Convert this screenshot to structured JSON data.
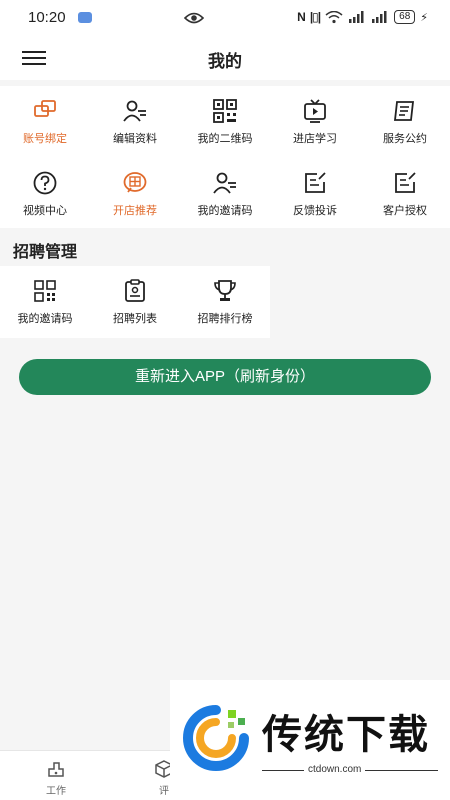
{
  "status_bar": {
    "time": "10:20",
    "battery": "68"
  },
  "header": {
    "title": "我的"
  },
  "grid": {
    "row1": [
      {
        "label": "账号绑定",
        "icon": "account-bind-icon"
      },
      {
        "label": "编辑资料",
        "icon": "edit-profile-icon"
      },
      {
        "label": "我的二维码",
        "icon": "qr-code-icon"
      },
      {
        "label": "进店学习",
        "icon": "tv-play-icon"
      },
      {
        "label": "服务公约",
        "icon": "contract-icon"
      }
    ],
    "row2": [
      {
        "label": "视频中心",
        "icon": "help-circle-icon"
      },
      {
        "label": "开店推荐",
        "icon": "alliance-icon"
      },
      {
        "label": "我的邀请码",
        "icon": "person-icon"
      },
      {
        "label": "反馈投诉",
        "icon": "feedback-icon"
      },
      {
        "label": "客户授权",
        "icon": "authorize-icon"
      }
    ]
  },
  "recruit": {
    "title": "招聘管理",
    "items": [
      {
        "label": "我的邀请码",
        "icon": "qr-code-icon"
      },
      {
        "label": "招聘列表",
        "icon": "list-icon"
      },
      {
        "label": "招聘排行榜",
        "icon": "trophy-icon"
      }
    ]
  },
  "reenter_button": "重新进入APP（刷新身份）",
  "bottom_nav": [
    {
      "label": "工作",
      "icon": "work-icon"
    },
    {
      "label": "评",
      "icon": "cube-icon"
    }
  ],
  "watermark": {
    "text": "传统下载",
    "domain": "ctdown.com"
  },
  "colors": {
    "accent": "#23875a",
    "highlight": "#e06a2b"
  }
}
